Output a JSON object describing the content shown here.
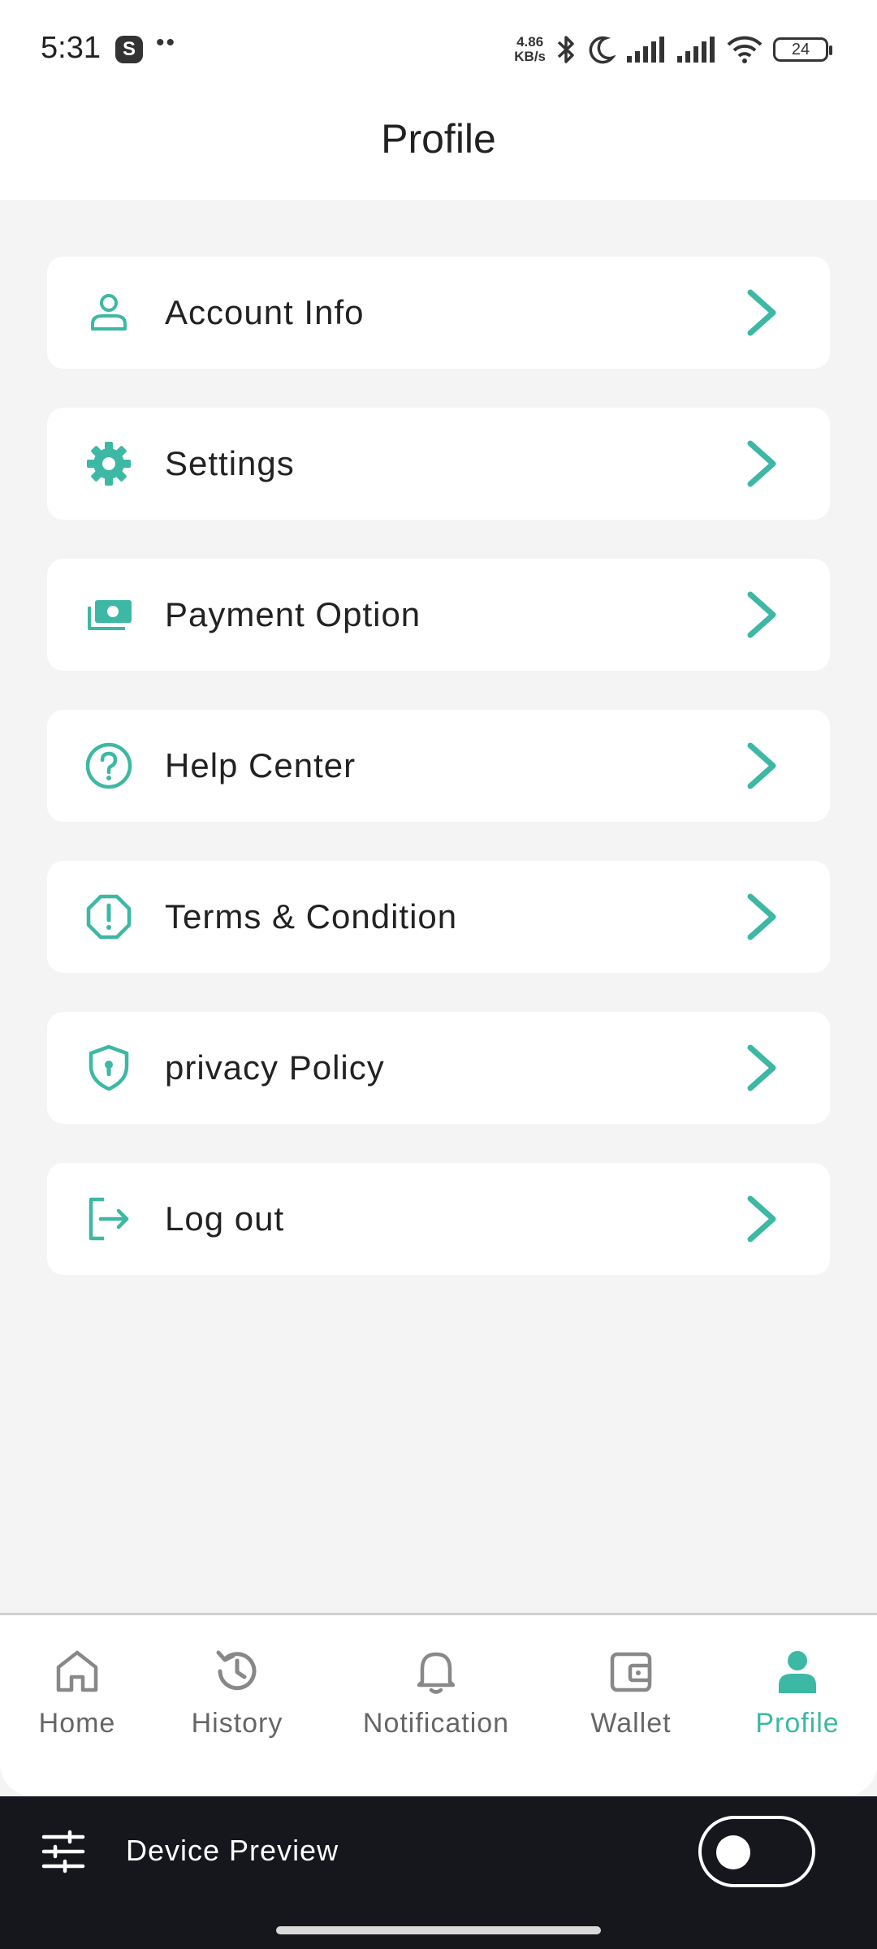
{
  "status_bar": {
    "time": "5:31",
    "app_badge": "S",
    "dots": "••",
    "net_speed_value": "4.86",
    "net_speed_unit": "KB/s",
    "battery": "24",
    "icons": [
      "bluetooth-icon",
      "moon-icon",
      "signal-icon",
      "signal-icon",
      "wifi-icon",
      "battery-icon"
    ]
  },
  "header": {
    "title": "Profile"
  },
  "menu": {
    "items": [
      {
        "label": "Account Info",
        "icon": "person-icon"
      },
      {
        "label": "Settings",
        "icon": "gear-icon"
      },
      {
        "label": "Payment Option",
        "icon": "money-icon"
      },
      {
        "label": "Help Center",
        "icon": "help-circle-icon"
      },
      {
        "label": "Terms & Condition",
        "icon": "alert-octagon-icon"
      },
      {
        "label": "privacy Policy",
        "icon": "shield-icon"
      },
      {
        "label": "Log out",
        "icon": "logout-icon"
      }
    ]
  },
  "bottom_nav": {
    "items": [
      {
        "label": "Home",
        "icon": "home-icon",
        "active": false
      },
      {
        "label": "History",
        "icon": "history-icon",
        "active": false
      },
      {
        "label": "Notification",
        "icon": "bell-icon",
        "active": false
      },
      {
        "label": "Wallet",
        "icon": "wallet-icon",
        "active": false
      },
      {
        "label": "Profile",
        "icon": "profile-icon",
        "active": true
      }
    ]
  },
  "device_preview": {
    "label": "Device Preview",
    "enabled": false
  },
  "colors": {
    "accent": "#3db8a4",
    "background": "#f4f4f4",
    "card": "#ffffff",
    "text": "#222222",
    "nav_inactive": "#888888",
    "preview_bar": "#16161d"
  }
}
